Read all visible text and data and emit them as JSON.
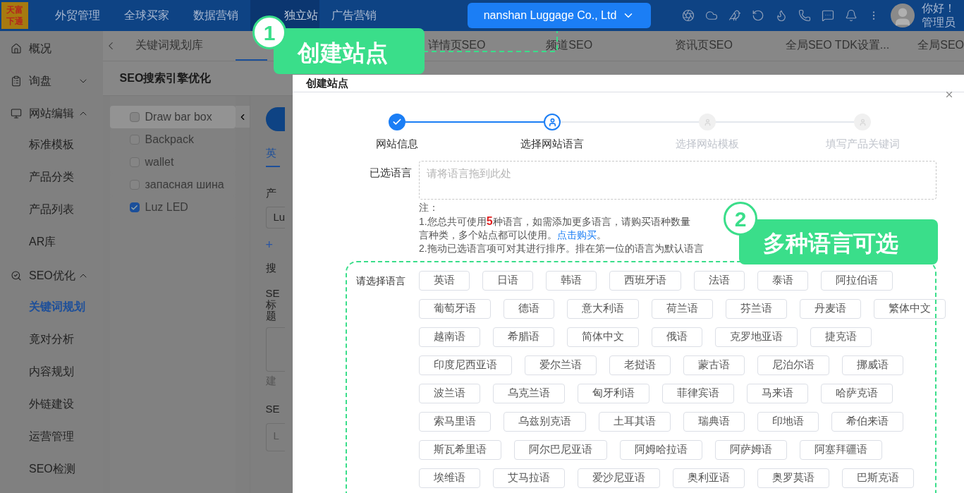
{
  "top_nav": {
    "logo": "天富下通",
    "items": [
      {
        "label": "外贸管理",
        "selected": false
      },
      {
        "label": "全球买家",
        "selected": false
      },
      {
        "label": "数据营销",
        "selected": false
      },
      {
        "label": "独立站",
        "selected": true
      },
      {
        "label": "广告营销",
        "selected": false
      }
    ],
    "company": "nanshan Luggage Co., Ltd",
    "greeting": "你好！",
    "role": "管理员"
  },
  "sidebar": {
    "items": [
      {
        "label": "概况"
      },
      {
        "label": "询盘",
        "expanded": false
      },
      {
        "label": "网站编辑",
        "expanded": true,
        "children": [
          {
            "label": "标准模板",
            "selected": false
          },
          {
            "label": "产品分类",
            "selected": false
          },
          {
            "label": "产品列表",
            "selected": false
          },
          {
            "label": "AR库",
            "selected": false
          }
        ]
      },
      {
        "label": "SEO优化",
        "expanded": true,
        "children": [
          {
            "label": "关键词规划",
            "selected": true
          },
          {
            "label": "竟对分析",
            "selected": false
          },
          {
            "label": "内容规划",
            "selected": false
          },
          {
            "label": "外链建设",
            "selected": false
          },
          {
            "label": "运营管理",
            "selected": false
          },
          {
            "label": "SEO检测",
            "selected": false
          }
        ]
      }
    ]
  },
  "tabs": [
    {
      "label": "关键词规划库",
      "selected": false
    },
    {
      "label": "详情页SEO",
      "selected": false
    },
    {
      "label": "频道SEO",
      "selected": false
    },
    {
      "label": "资讯页SEO",
      "selected": false
    },
    {
      "label": "全局SEO TDK设置...",
      "selected": false
    },
    {
      "label": "全局SEO",
      "selected": false
    }
  ],
  "page_title": "SEO搜索引擎优化",
  "products": [
    {
      "name": "Draw bar box",
      "checked": false,
      "selected": true
    },
    {
      "name": "Backpack",
      "checked": false,
      "selected": false
    },
    {
      "name": "wallet",
      "checked": false,
      "selected": false
    },
    {
      "name": "запасная шина",
      "checked": false,
      "selected": false
    },
    {
      "name": "Luz LED",
      "checked": true,
      "selected": false
    }
  ],
  "form_peek": {
    "tab": "英",
    "label_1": "产",
    "input_1": "Lu",
    "add": "+",
    "label_2": "搜",
    "label_3": "SE",
    "label_3b": "标",
    "label_3c": "题",
    "hint": "建",
    "label_4": "SE",
    "input_2": "L"
  },
  "callouts": [
    {
      "number": "1",
      "text": "创建站点"
    },
    {
      "number": "2",
      "text": "多种语言可选"
    }
  ],
  "dialog": {
    "title": "创建站点",
    "steps": [
      {
        "label": "网站信息",
        "completed": true,
        "selected": false
      },
      {
        "label": "选择网站语言",
        "completed": false,
        "selected": true
      },
      {
        "label": "选择网站模板",
        "completed": false,
        "selected": false
      },
      {
        "label": "填写产品关键词",
        "completed": false,
        "selected": false
      }
    ],
    "selected_label": "已选语言",
    "drop_placeholder": "请将语言拖到此处",
    "notes": [
      "注：",
      "1.您总共可使用**5**种语言，如需添加更多语言，请购买语种数量",
      "言种类，多个站点都可以使用。",
      "2.拖动已选语言项可对其进行排序。排在第一位的语言为默认语言"
    ],
    "buy_link": "点击购买",
    "buy_after": "。",
    "choose_label": "请选择语言",
    "language_rows": [
      [
        "英语",
        "日语",
        "韩语",
        "西班牙语",
        "法语",
        "泰语",
        "阿拉伯语"
      ],
      [
        "葡萄牙语",
        "德语",
        "意大利语",
        "荷兰语",
        "芬兰语",
        "丹麦语",
        "繁体中文"
      ],
      [
        "越南语",
        "希腊语",
        "简体中文",
        "俄语",
        "克罗地亚语",
        "捷克语"
      ],
      [
        "印度尼西亚语",
        "爱尔兰语",
        "老挝语",
        "蒙古语",
        "尼泊尔语",
        "挪威语"
      ],
      [
        "波兰语",
        "乌克兰语",
        "匈牙利语",
        "菲律宾语",
        "马来语",
        "哈萨克语"
      ],
      [
        "索马里语",
        "乌兹别克语",
        "土耳其语",
        "瑞典语",
        "印地语",
        "希伯来语"
      ],
      [
        "斯瓦希里语",
        "阿尔巴尼亚语",
        "阿姆哈拉语",
        "阿萨姆语",
        "阿塞拜疆语"
      ],
      [
        "埃维语",
        "艾马拉语",
        "爱沙尼亚语",
        "奥利亚语",
        "奥罗莫语",
        "巴斯克语"
      ]
    ]
  }
}
